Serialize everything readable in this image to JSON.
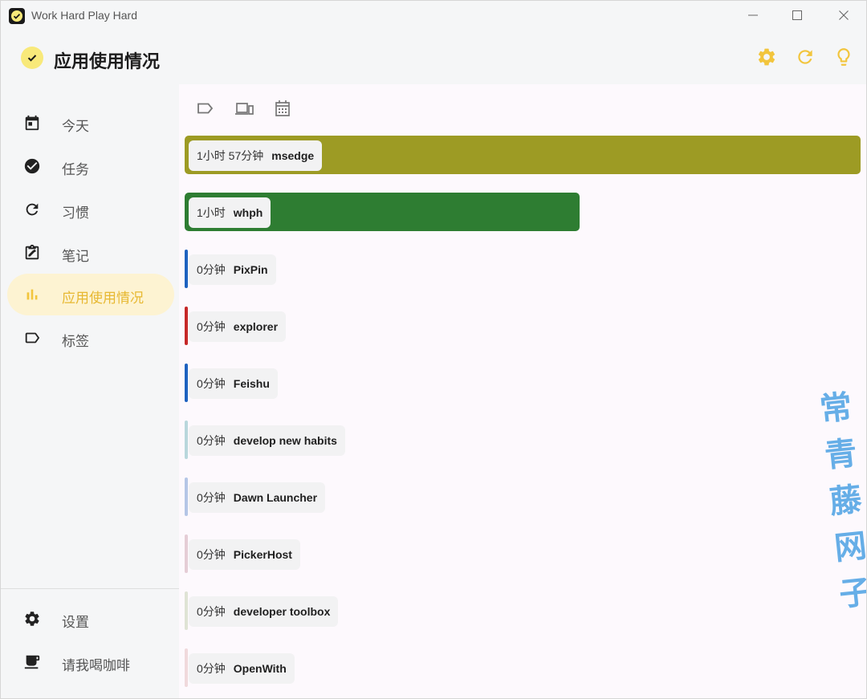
{
  "window": {
    "title": "Work Hard Play Hard"
  },
  "header": {
    "title": "应用使用情况"
  },
  "sidebar": {
    "items": [
      {
        "label": "今天",
        "icon": "calendar-today-icon"
      },
      {
        "label": "任务",
        "icon": "check-circle-icon"
      },
      {
        "label": "习惯",
        "icon": "refresh-icon"
      },
      {
        "label": "笔记",
        "icon": "note-edit-icon"
      },
      {
        "label": "应用使用情况",
        "icon": "bar-chart-icon",
        "active": true
      },
      {
        "label": "标签",
        "icon": "label-icon"
      }
    ],
    "bottom": [
      {
        "label": "设置",
        "icon": "gear-icon"
      },
      {
        "label": "请我喝咖啡",
        "icon": "coffee-cup-icon"
      }
    ]
  },
  "colors": {
    "accent": "#f2c53d",
    "active_bg": "#fdf3d2",
    "active_text": "#e7b831"
  },
  "usage": [
    {
      "duration": "1小时 57分钟",
      "app": "msedge",
      "color": "#9d9b24",
      "fraction": 1.0
    },
    {
      "duration": "1小时",
      "app": "whph",
      "color": "#2e7d32",
      "fraction": 0.584
    },
    {
      "duration": "0分钟",
      "app": "PixPin",
      "color": "#1e62c0",
      "fraction": 0
    },
    {
      "duration": "0分钟",
      "app": "explorer",
      "color": "#c62828",
      "fraction": 0
    },
    {
      "duration": "0分钟",
      "app": "Feishu",
      "color": "#1e62c0",
      "fraction": 0
    },
    {
      "duration": "0分钟",
      "app": "develop new habits",
      "color": "#b9d7dc",
      "fraction": 0
    },
    {
      "duration": "0分钟",
      "app": "Dawn Launcher",
      "color": "#b5c6e6",
      "fraction": 0
    },
    {
      "duration": "0分钟",
      "app": "PickerHost",
      "color": "#e5cdd6",
      "fraction": 0
    },
    {
      "duration": "0分钟",
      "app": "developer toolbox",
      "color": "#dfe3d5",
      "fraction": 0
    },
    {
      "duration": "0分钟",
      "app": "OpenWith",
      "color": "#f0d9dc",
      "fraction": 0
    }
  ],
  "watermark": "常青藤网子"
}
